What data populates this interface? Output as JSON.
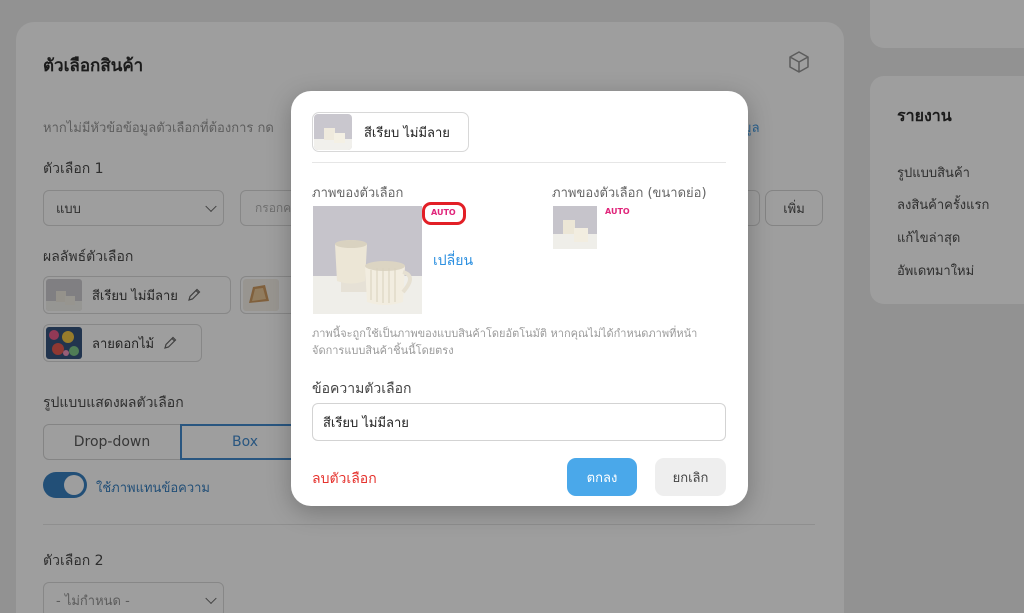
{
  "page": {
    "section_title": "ตัวเลือกสินค้า",
    "hint_text": "หากไม่มีหัวข้อข้อมูลตัวเลือกที่ต้องการ กด",
    "hint_link": "มูล",
    "option1_label": "ตัวเลือก 1",
    "option1_type": "แบบ",
    "option1_input_placeholder": "กรอกค",
    "add_button": "เพิ่ม",
    "products_label": "ผลลัพธ์ตัวเลือก",
    "chips": [
      {
        "label": "สีเรียบ ไม่มีลาย"
      },
      {
        "label": "ลายดอกไม้"
      }
    ],
    "display_label": "รูปแบบแสดงผลตัวเลือก",
    "display_modes": [
      "Drop-down",
      "Box"
    ],
    "toggle_label": "ใช้ภาพแทนข้อความ",
    "option2_label": "ตัวเลือก 2",
    "option2_placeholder": "- ไม่กำหนด -"
  },
  "sidebar": {
    "title": "รายงาน",
    "items": [
      "รูปแบบสินค้า",
      "ลงสินค้าครั้งแรก",
      "แก้ไขล่าสุด",
      "อัพเดทมาใหม่"
    ]
  },
  "modal": {
    "chip_label": "สีเรียบ ไม่มีลาย",
    "image_label": "ภาพของตัวเลือก",
    "thumb_label": "ภาพของตัวเลือก (ขนาดย่อ)",
    "auto_badge": "AUTO",
    "change_link": "เปลี่ยน",
    "note": "ภาพนี้จะถูกใช้เป็นภาพของแบบสินค้าโดยอัตโนมัติ หากคุณไม่ได้กำหนดภาพที่หน้าจัดการแบบสินค้าชิ้นนี้โดยตรง",
    "text_label": "ข้อความตัวเลือก",
    "text_value": "สีเรียบ ไม่มีลาย",
    "delete_button": "ลบตัวเลือก",
    "ok_button": "ตกลง",
    "cancel_button": "ยกเลิก"
  },
  "colors": {
    "accent": "#2b8fe0",
    "ok_button": "#4aa8ea",
    "danger": "#e5322d",
    "auto_badge": "#e0247a",
    "highlight_ring": "#e21f26"
  }
}
